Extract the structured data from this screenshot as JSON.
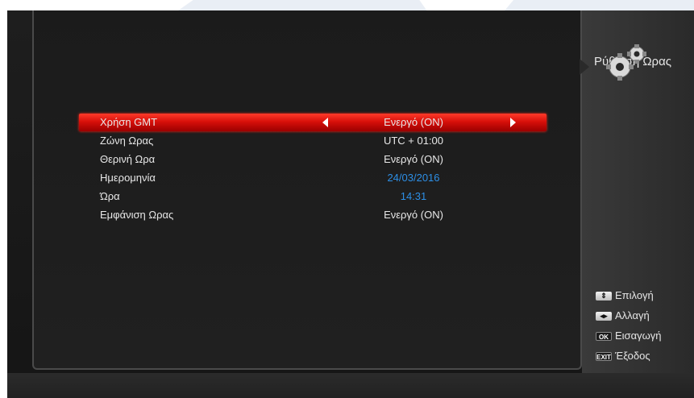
{
  "screen": {
    "title": "Ρύθμιση Ωρας",
    "title_icon": "gears-icon"
  },
  "menu": {
    "rows": [
      {
        "label": "Χρήση GMT",
        "value": "Ενεργό (ON)",
        "selected": true
      },
      {
        "label": "Ζώνη Ωρας",
        "value": "UTC + 01:00"
      },
      {
        "label": "Θερινή Ωρα",
        "value": "Ενεργό (ON)"
      },
      {
        "label": "Ημερομηνία",
        "value": "24/03/2016",
        "color": "#2d8fe6"
      },
      {
        "label": "Ώρα",
        "value": "14:31",
        "color": "#2d8fe6"
      },
      {
        "label": "Εμφάνιση Ωρας",
        "value": "Ενεργό (ON)"
      }
    ]
  },
  "help": {
    "items": [
      {
        "key": "⇕",
        "label": "Επιλογή"
      },
      {
        "key": "◂▸",
        "label": "Αλλαγή"
      },
      {
        "key": "OK",
        "label": "Εισαγωγή"
      },
      {
        "key": "EXIT",
        "label": "Έξοδος"
      }
    ]
  },
  "colors": {
    "selection": "#d8100a",
    "date_value": "#2d8fe6",
    "panel_border": "#4a4a4a"
  }
}
